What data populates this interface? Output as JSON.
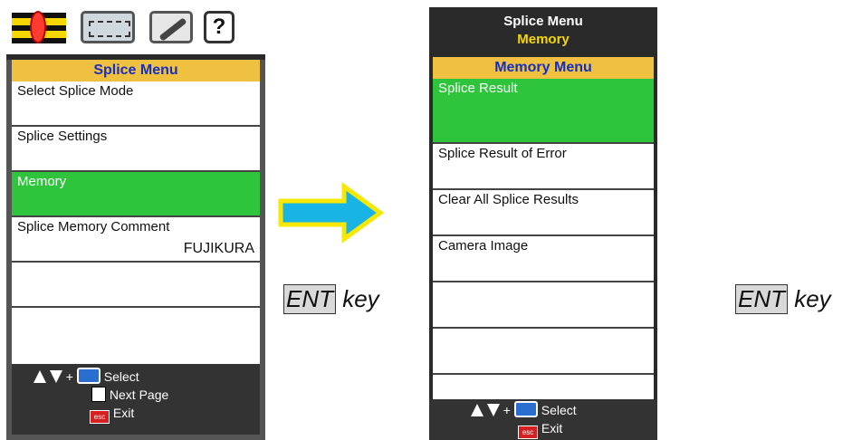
{
  "left": {
    "tabs": [
      {
        "icon": "splice-tab-icon"
      },
      {
        "icon": "heater-tab-icon"
      },
      {
        "icon": "maintenance-tab-icon"
      },
      {
        "icon": "help-tab-icon",
        "label": "?"
      }
    ],
    "header": "Splice Menu",
    "items": [
      {
        "label": "Select Splice Mode",
        "sub": ""
      },
      {
        "label": "Splice Settings",
        "sub": ""
      },
      {
        "label": "Memory",
        "sub": "",
        "selected": true
      },
      {
        "label": "Splice Memory Comment",
        "sub": "FUJIKURA"
      },
      {
        "label": "",
        "sub": ""
      },
      {
        "label": "",
        "sub": ""
      }
    ],
    "footer": {
      "plus": "+",
      "select": "Select",
      "next_page": "Next Page",
      "exit": "Exit",
      "esc": "esc"
    }
  },
  "ent_label": {
    "key": "ENT",
    "suffix": " key"
  },
  "right": {
    "title": "Splice Menu",
    "subtitle": "Memory",
    "header": "Memory Menu",
    "items": [
      {
        "label": "Splice Result",
        "selected": true
      },
      {
        "label": "Splice Result of Error"
      },
      {
        "label": "Clear All Splice Results"
      },
      {
        "label": "Camera Image"
      },
      {
        "label": ""
      },
      {
        "label": ""
      },
      {
        "label": ""
      }
    ],
    "footer": {
      "plus": "+",
      "select": "Select",
      "exit": "Exit",
      "esc": "esc"
    }
  },
  "colors": {
    "selected": "#2ec43c",
    "header_bg": "#f0c040",
    "header_text": "#1530c0",
    "arrow_fill": "#19b4e6",
    "arrow_stroke": "#f6e800"
  }
}
